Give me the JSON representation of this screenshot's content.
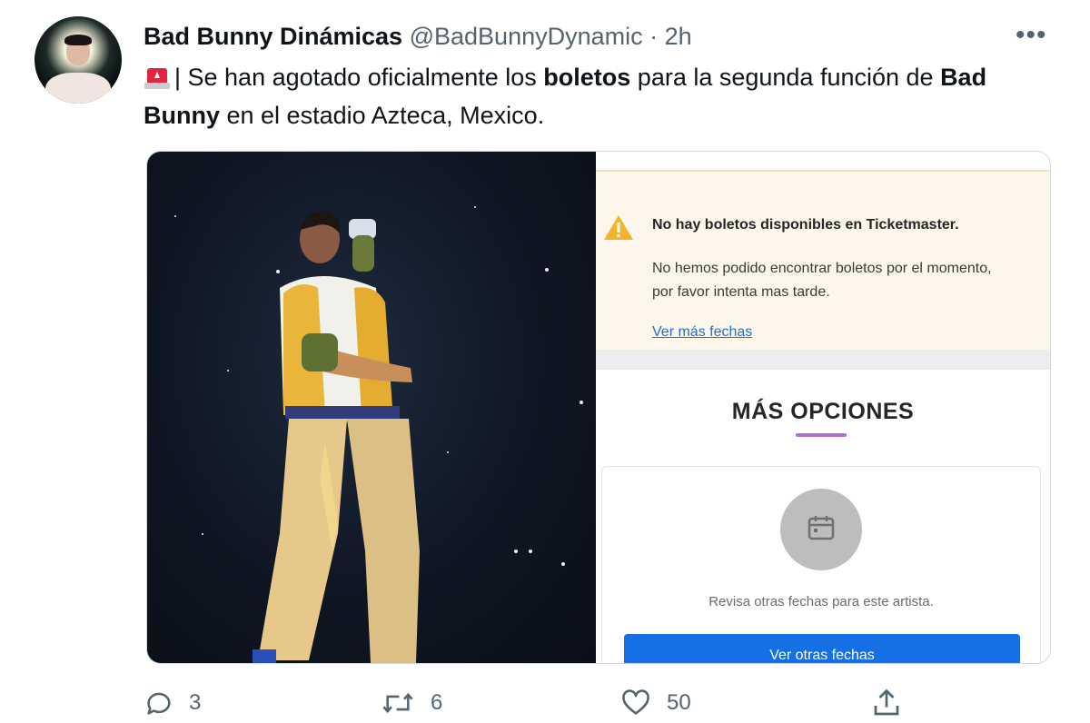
{
  "author": {
    "name": "Bad Bunny Dinámicas",
    "handle": "@BadBunnyDynamic",
    "separator": "·",
    "time": "2h"
  },
  "more_label": "•••",
  "tweet": {
    "text_1": "| Se han agotado oficialmente los ",
    "bold_1": "boletos",
    "text_2": " para la segunda función de ",
    "bold_2": "Bad Bunny",
    "text_3": " en el estadio Azteca, Mexico."
  },
  "screenshot": {
    "warning_title": "No hay boletos disponibles en Ticketmaster.",
    "warning_body": "No hemos podido encontrar boletos por el momento, por favor intenta mas tarde.",
    "warning_link": "Ver más fechas",
    "options_title": "MÁS OPCIONES",
    "card_text": "Revisa otras fechas para este artista.",
    "card_button": "Ver otras fechas"
  },
  "actions": {
    "replies": "3",
    "retweets": "6",
    "likes": "50"
  },
  "colors": {
    "text": "#0f1419",
    "secondary": "#536471",
    "warning_bg": "#fcf7ea",
    "button_blue": "#1570e5",
    "accent_purple": "#b36bd6",
    "emoji_red": "#e0263c"
  },
  "icons": [
    "siren-emoji",
    "warning-icon",
    "calendar-icon",
    "reply-icon",
    "retweet-icon",
    "like-icon",
    "share-icon"
  ]
}
